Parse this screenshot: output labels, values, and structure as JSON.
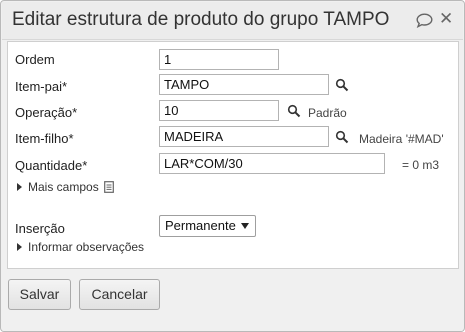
{
  "dialog": {
    "title": "Editar estrutura de produto do grupo TAMPO",
    "icons": {
      "comment": "comment-icon",
      "close": "close-icon",
      "search": "search-icon",
      "doc": "document-icon"
    }
  },
  "form": {
    "ordem": {
      "label": "Ordem",
      "value": "1"
    },
    "item_pai": {
      "label": "Item-pai*",
      "value": "TAMPO"
    },
    "operacao": {
      "label": "Operação*",
      "value": "10",
      "hint": "Padrão"
    },
    "item_filho": {
      "label": "Item-filho*",
      "value": "MADEIRA",
      "hint": "Madeira '#MAD'"
    },
    "quantidade": {
      "label": "Quantidade*",
      "value": "LAR*COM/30",
      "hint": "= 0 m3"
    },
    "mais_campos": "Mais campos",
    "insercao": {
      "label": "Inserção",
      "selected": "Permanente"
    },
    "observacoes": "Informar observações"
  },
  "footer": {
    "save_label": "Salvar",
    "cancel_label": "Cancelar"
  },
  "colors": {
    "panel_bg": "#f0f0f0",
    "content_bg": "#ffffff",
    "border": "#b3b3b3"
  }
}
